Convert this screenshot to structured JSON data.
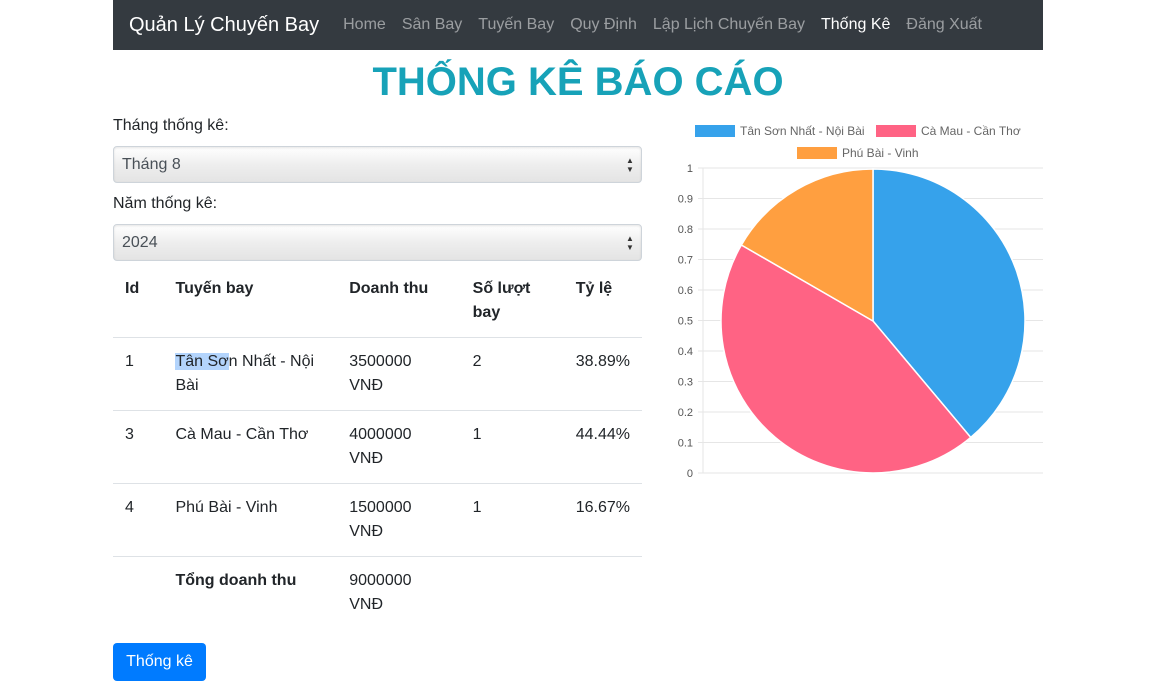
{
  "navbar": {
    "brand": "Quản Lý Chuyến Bay",
    "links": [
      {
        "label": "Home",
        "active": false
      },
      {
        "label": "Sân Bay",
        "active": false
      },
      {
        "label": "Tuyến Bay",
        "active": false
      },
      {
        "label": "Quy Định",
        "active": false
      },
      {
        "label": "Lập Lịch Chuyến Bay",
        "active": false
      },
      {
        "label": "Thống Kê",
        "active": true
      },
      {
        "label": "Đăng Xuất",
        "active": false
      }
    ]
  },
  "page": {
    "title": "THỐNG KÊ BÁO CÁO",
    "month_label": "Tháng thống kê:",
    "month_value": "Tháng 8",
    "year_label": "Năm thống kê:",
    "year_value": "2024",
    "submit_label": "Thống kê"
  },
  "table": {
    "headers": [
      "Id",
      "Tuyến bay",
      "Doanh thu",
      "Số lượt bay",
      "Tỷ lệ"
    ],
    "rows": [
      {
        "id": "1",
        "route": "Tân Sơn Nhất - Nội Bài",
        "route_highlight": "Tân Sơ",
        "route_rest": "n Nhất - Nội Bài",
        "revenue": "3500000 VNĐ",
        "flights": "2",
        "ratio": "38.89%"
      },
      {
        "id": "3",
        "route": "Cà Mau - Cần Thơ",
        "revenue": "4000000 VNĐ",
        "flights": "1",
        "ratio": "44.44%"
      },
      {
        "id": "4",
        "route": "Phú Bài - Vinh",
        "revenue": "1500000 VNĐ",
        "flights": "1",
        "ratio": "16.67%"
      }
    ],
    "total_label": "Tổng doanh thu",
    "total_value": "9000000 VNĐ"
  },
  "chart_data": {
    "type": "pie",
    "categories": [
      "Tân Sơn Nhất - Nội Bài",
      "Cà Mau - Cần Thơ",
      "Phú Bài - Vinh"
    ],
    "values": [
      3500000,
      4000000,
      1500000
    ],
    "colors": [
      "#36a2eb",
      "#ff6384",
      "#ff9f40"
    ],
    "legend_position": "top",
    "y_ticks": [
      "1",
      "0.9",
      "0.8",
      "0.7",
      "0.6",
      "0.5",
      "0.4",
      "0.3",
      "0.2",
      "0.1",
      "0"
    ],
    "ylim": [
      0,
      1
    ],
    "grid": true
  }
}
